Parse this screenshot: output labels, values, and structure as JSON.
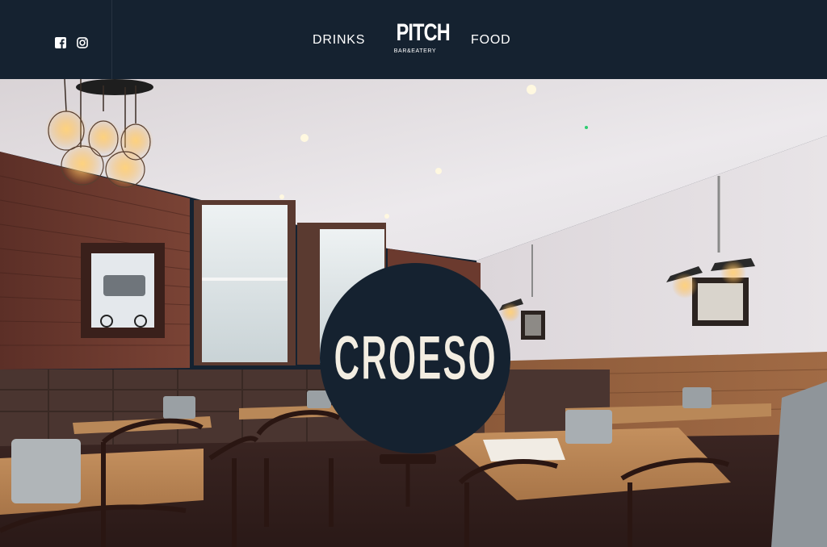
{
  "header": {
    "nav_left": "DRINKS",
    "nav_right": "FOOD",
    "logo_main": "PITCH",
    "logo_sub": "BAR&EATERY",
    "social": [
      {
        "icon": "facebook-icon"
      },
      {
        "icon": "instagram-icon"
      }
    ]
  },
  "hero": {
    "badge_text": "CROESO",
    "scene": "restaurant-interior-photo"
  },
  "colors": {
    "header_bg": "#152230",
    "badge_bg": "#152230",
    "badge_text": "#f3eee2",
    "nav_text": "#ffffff"
  }
}
